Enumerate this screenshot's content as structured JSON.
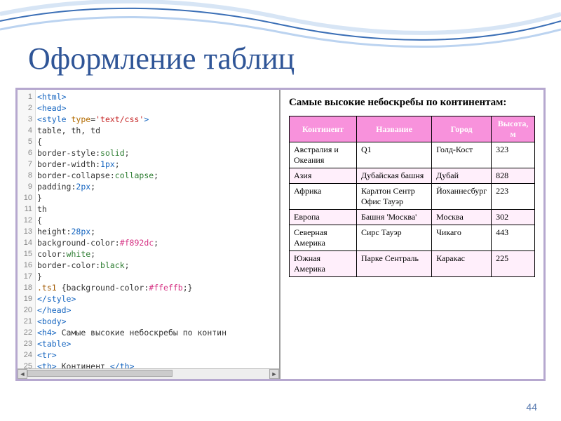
{
  "title": "Оформление таблиц",
  "page_number": "44",
  "code": {
    "lines": [
      {
        "n": "1",
        "html": "<span class='tag'>&lt;html&gt;</span>"
      },
      {
        "n": "2",
        "html": "<span class='tag'>&lt;head&gt;</span>"
      },
      {
        "n": "3",
        "html": "<span class='tag'>&lt;style</span> <span class='attr'>type</span>=<span class='str'>'text/css'</span><span class='tag'>&gt;</span>"
      },
      {
        "n": "4",
        "html": "<span class='txt'>table, th, td</span>"
      },
      {
        "n": "5",
        "html": "<span class='txt'>{</span>"
      },
      {
        "n": "6",
        "html": "<span class='txt'>border-style:</span><span class='val'>solid</span><span class='txt'>;</span>"
      },
      {
        "n": "7",
        "html": "<span class='txt'>border-width:</span><span class='num'>1px</span><span class='txt'>;</span>"
      },
      {
        "n": "8",
        "html": "<span class='txt'>border-collapse:</span><span class='val'>collapse</span><span class='txt'>;</span>"
      },
      {
        "n": "9",
        "html": "<span class='txt'>padding:</span><span class='num'>2px</span><span class='txt'>;</span>"
      },
      {
        "n": "10",
        "html": "<span class='txt'>}</span>"
      },
      {
        "n": "11",
        "html": "<span class='txt'>th</span>"
      },
      {
        "n": "12",
        "html": "<span class='txt'>{</span>"
      },
      {
        "n": "13",
        "html": "<span class='txt'>height:</span><span class='num'>28px</span><span class='txt'>;</span>"
      },
      {
        "n": "14",
        "html": "<span class='txt'>background-color:</span><span class='hex'>#f892dc</span><span class='txt'>;</span>"
      },
      {
        "n": "15",
        "html": "<span class='txt'>color:</span><span class='val'>white</span><span class='txt'>;</span>"
      },
      {
        "n": "16",
        "html": "<span class='txt'>border-color:</span><span class='val'>black</span><span class='txt'>;</span>"
      },
      {
        "n": "17",
        "html": "<span class='txt'>}</span>"
      },
      {
        "n": "18",
        "html": "<span class='cls'>.ts1</span> <span class='txt'>{background-color:</span><span class='hex'>#ffeffb</span><span class='txt'>;}</span>"
      },
      {
        "n": "19",
        "html": "<span class='tag'>&lt;/style&gt;</span>"
      },
      {
        "n": "20",
        "html": "<span class='tag'>&lt;/head&gt;</span>"
      },
      {
        "n": "21",
        "html": "<span class='tag'>&lt;body&gt;</span>"
      },
      {
        "n": "22",
        "html": "<span class='tag'>&lt;h4&gt;</span><span class='txt'> Самые высокие небоскребы по контин</span>"
      },
      {
        "n": "23",
        "html": "<span class='tag'>&lt;table&gt;</span>"
      },
      {
        "n": "24",
        "html": "<span class='tag'>&lt;tr&gt;</span>"
      },
      {
        "n": "25",
        "html": "<span class='tag'>&lt;th&gt;</span><span class='txt'> Континент </span><span class='tag'>&lt;/th&gt;</span>"
      }
    ]
  },
  "preview": {
    "heading": "Самые высокие небоскребы по континентам:",
    "headers": [
      "Континент",
      "Название",
      "Город",
      "Высота, м"
    ],
    "rows": [
      {
        "alt": false,
        "c": [
          "Австралия и Океания",
          "Q1",
          "Голд-Кост",
          "323"
        ]
      },
      {
        "alt": true,
        "c": [
          "Азия",
          "Дубайская башня",
          "Дубай",
          "828"
        ]
      },
      {
        "alt": false,
        "c": [
          "Африка",
          "Карлтон Сентр Офис Тауэр",
          "Йоханнесбург",
          "223"
        ]
      },
      {
        "alt": true,
        "c": [
          "Европа",
          "Башня 'Москва'",
          "Москва",
          "302"
        ]
      },
      {
        "alt": false,
        "c": [
          "Северная Америка",
          "Сирс Тауэр",
          "Чикаго",
          "443"
        ]
      },
      {
        "alt": true,
        "c": [
          "Южная Америка",
          "Парке Сентраль",
          "Каракас",
          "225"
        ]
      }
    ]
  },
  "chart_data": {
    "type": "table",
    "title": "Самые высокие небоскребы по континентам",
    "columns": [
      "Континент",
      "Название",
      "Город",
      "Высота, м"
    ],
    "rows": [
      [
        "Австралия и Океания",
        "Q1",
        "Голд-Кост",
        323
      ],
      [
        "Азия",
        "Дубайская башня",
        "Дубай",
        828
      ],
      [
        "Африка",
        "Карлтон Сентр Офис Тауэр",
        "Йоханнесбург",
        223
      ],
      [
        "Европа",
        "Башня 'Москва'",
        "Москва",
        302
      ],
      [
        "Северная Америка",
        "Сирс Тауэр",
        "Чикаго",
        443
      ],
      [
        "Южная Америка",
        "Парке Сентраль",
        "Каракас",
        225
      ]
    ]
  }
}
